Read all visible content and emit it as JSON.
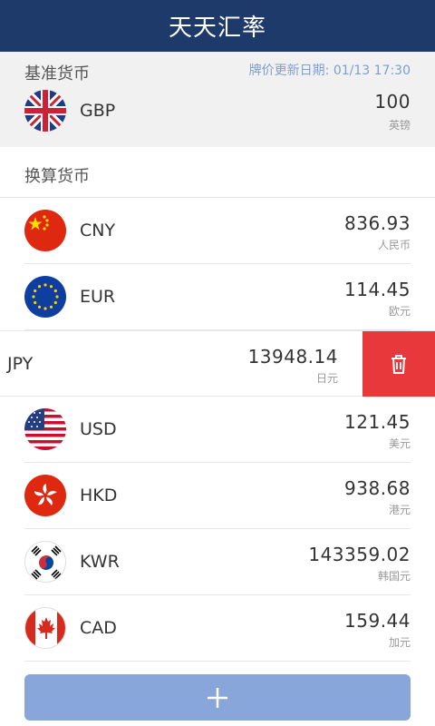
{
  "app": {
    "title": "天天汇率"
  },
  "base": {
    "label": "基准货币",
    "update_label": "牌价更新日期:",
    "update_time": "01/13 17:30",
    "currency": {
      "code": "GBP",
      "amount": "100",
      "unit": "英镑",
      "flag_icon": "uk-flag-icon"
    }
  },
  "conversion": {
    "label": "换算货币",
    "items": [
      {
        "code": "CNY",
        "amount": "836.93",
        "unit": "人民币",
        "flag_icon": "china-flag-icon"
      },
      {
        "code": "EUR",
        "amount": "114.45",
        "unit": "欧元",
        "flag_icon": "eu-flag-icon"
      },
      {
        "code": "JPY",
        "amount": "13948.14",
        "unit": "日元",
        "flag_icon": "japan-flag-icon",
        "swiped": true
      },
      {
        "code": "USD",
        "amount": "121.45",
        "unit": "美元",
        "flag_icon": "usa-flag-icon"
      },
      {
        "code": "HKD",
        "amount": "938.68",
        "unit": "港元",
        "flag_icon": "hongkong-flag-icon"
      },
      {
        "code": "KWR",
        "amount": "143359.02",
        "unit": "韩国元",
        "flag_icon": "korea-flag-icon"
      },
      {
        "code": "CAD",
        "amount": "159.44",
        "unit": "加元",
        "flag_icon": "canada-flag-icon"
      }
    ]
  },
  "actions": {
    "delete_icon": "trash-icon",
    "add_icon": "plus-icon"
  },
  "colors": {
    "header": "#1d3a6a",
    "accent_text": "#7d9fd0",
    "delete": "#e9383c",
    "add_button": "#88a6da"
  }
}
